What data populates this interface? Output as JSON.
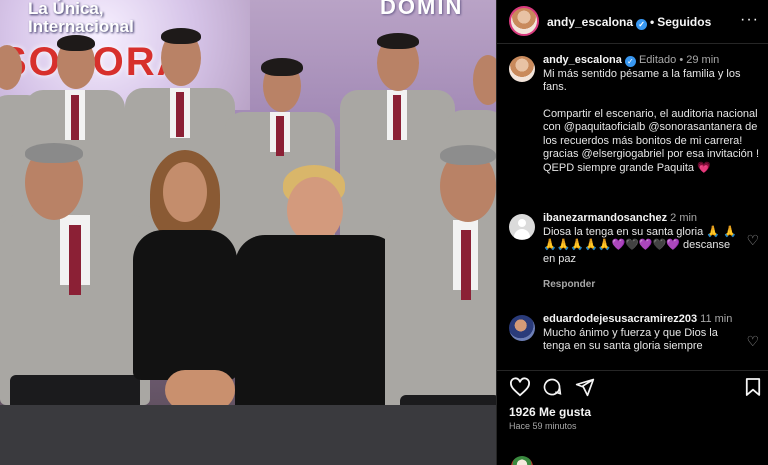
{
  "photo": {
    "banner_top": "La Única,\nInternacional",
    "banner_logo": "SONORA",
    "banner_right": "DOMIN"
  },
  "header": {
    "username": "andy_escalona",
    "follow_status": "Seguidos",
    "more": "···"
  },
  "caption": {
    "username": "andy_escalona",
    "edited": "Editado",
    "time": "29 min",
    "paragraph1": "Mi más sentido pésame a la familia y los fans.",
    "paragraph2": "Compartir el escenario, el auditoria nacional con @paquitaoficialb @sonorasantanera de los recuerdos más bonitos de mi carrera! gracias @elsergiogabriel por esa invitación ! QEPD siempre grande Paquita",
    "heart": "💗"
  },
  "comments": [
    {
      "username": "ibanezarmandosanchez",
      "time": "2 min",
      "text": "Diosa la tenga en su santa gloria 🙏 🙏🙏🙏🙏🙏🙏💜🖤💜🖤💜 descanse en paz",
      "reply": "Responder"
    },
    {
      "username": "eduardodejesusacramirez203",
      "time": "11 min",
      "text": "Mucho ánimo y fuerza y que Dios la tenga en su santa gloria siempre"
    }
  ],
  "actions": {
    "like_icon": "heart-icon",
    "comment_icon": "comment-icon",
    "share_icon": "share-icon",
    "save_icon": "bookmark-icon"
  },
  "likes": "1926 Me gusta",
  "posted": "Hace 59 minutos",
  "colors": {
    "background": "#000000",
    "verified": "#3897f0",
    "muted": "#a8a8a8",
    "story_ring": "#d93a7e"
  }
}
